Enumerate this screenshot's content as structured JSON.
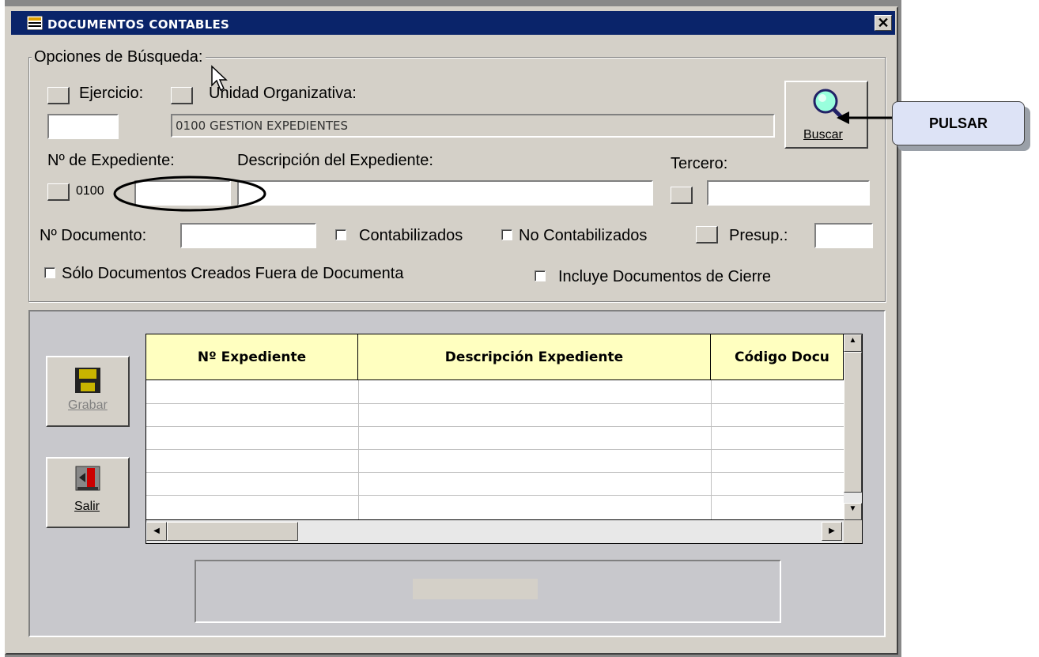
{
  "window": {
    "title": "DOCUMENTOS CONTABLES",
    "close": "✕"
  },
  "search": {
    "group_label": "Opciones de Búsqueda:",
    "ejercicio_label": "Ejercicio:",
    "unidad_label": "Unidad Organizativa:",
    "unidad_value": "0100  GESTION EXPEDIENTES",
    "expediente_label": "Nº de Expediente:",
    "expediente_prefix": "0100",
    "descripcion_label": "Descripción del Expediente:",
    "tercero_label": "Tercero:",
    "documento_label": "Nº Documento:",
    "contabilizados_label": "Contabilizados",
    "no_contabilizados_label": "No Contabilizados",
    "presup_label": "Presup.:",
    "solo_label": "Sólo Documentos Creados Fuera de Documenta",
    "incluye_label": "Incluye Documentos  de Cierre",
    "buscar_label": "Buscar"
  },
  "actions": {
    "grabar_label": "Grabar",
    "salir_label": "Salir"
  },
  "grid": {
    "columns": [
      "Nº Expediente",
      "Descripción Expediente",
      "Código Docu"
    ]
  },
  "callout": {
    "text": "PULSAR"
  },
  "colors": {
    "title_bar": "#0a246a",
    "face": "#d4d0c8",
    "grid_header": "#ffffc0"
  }
}
